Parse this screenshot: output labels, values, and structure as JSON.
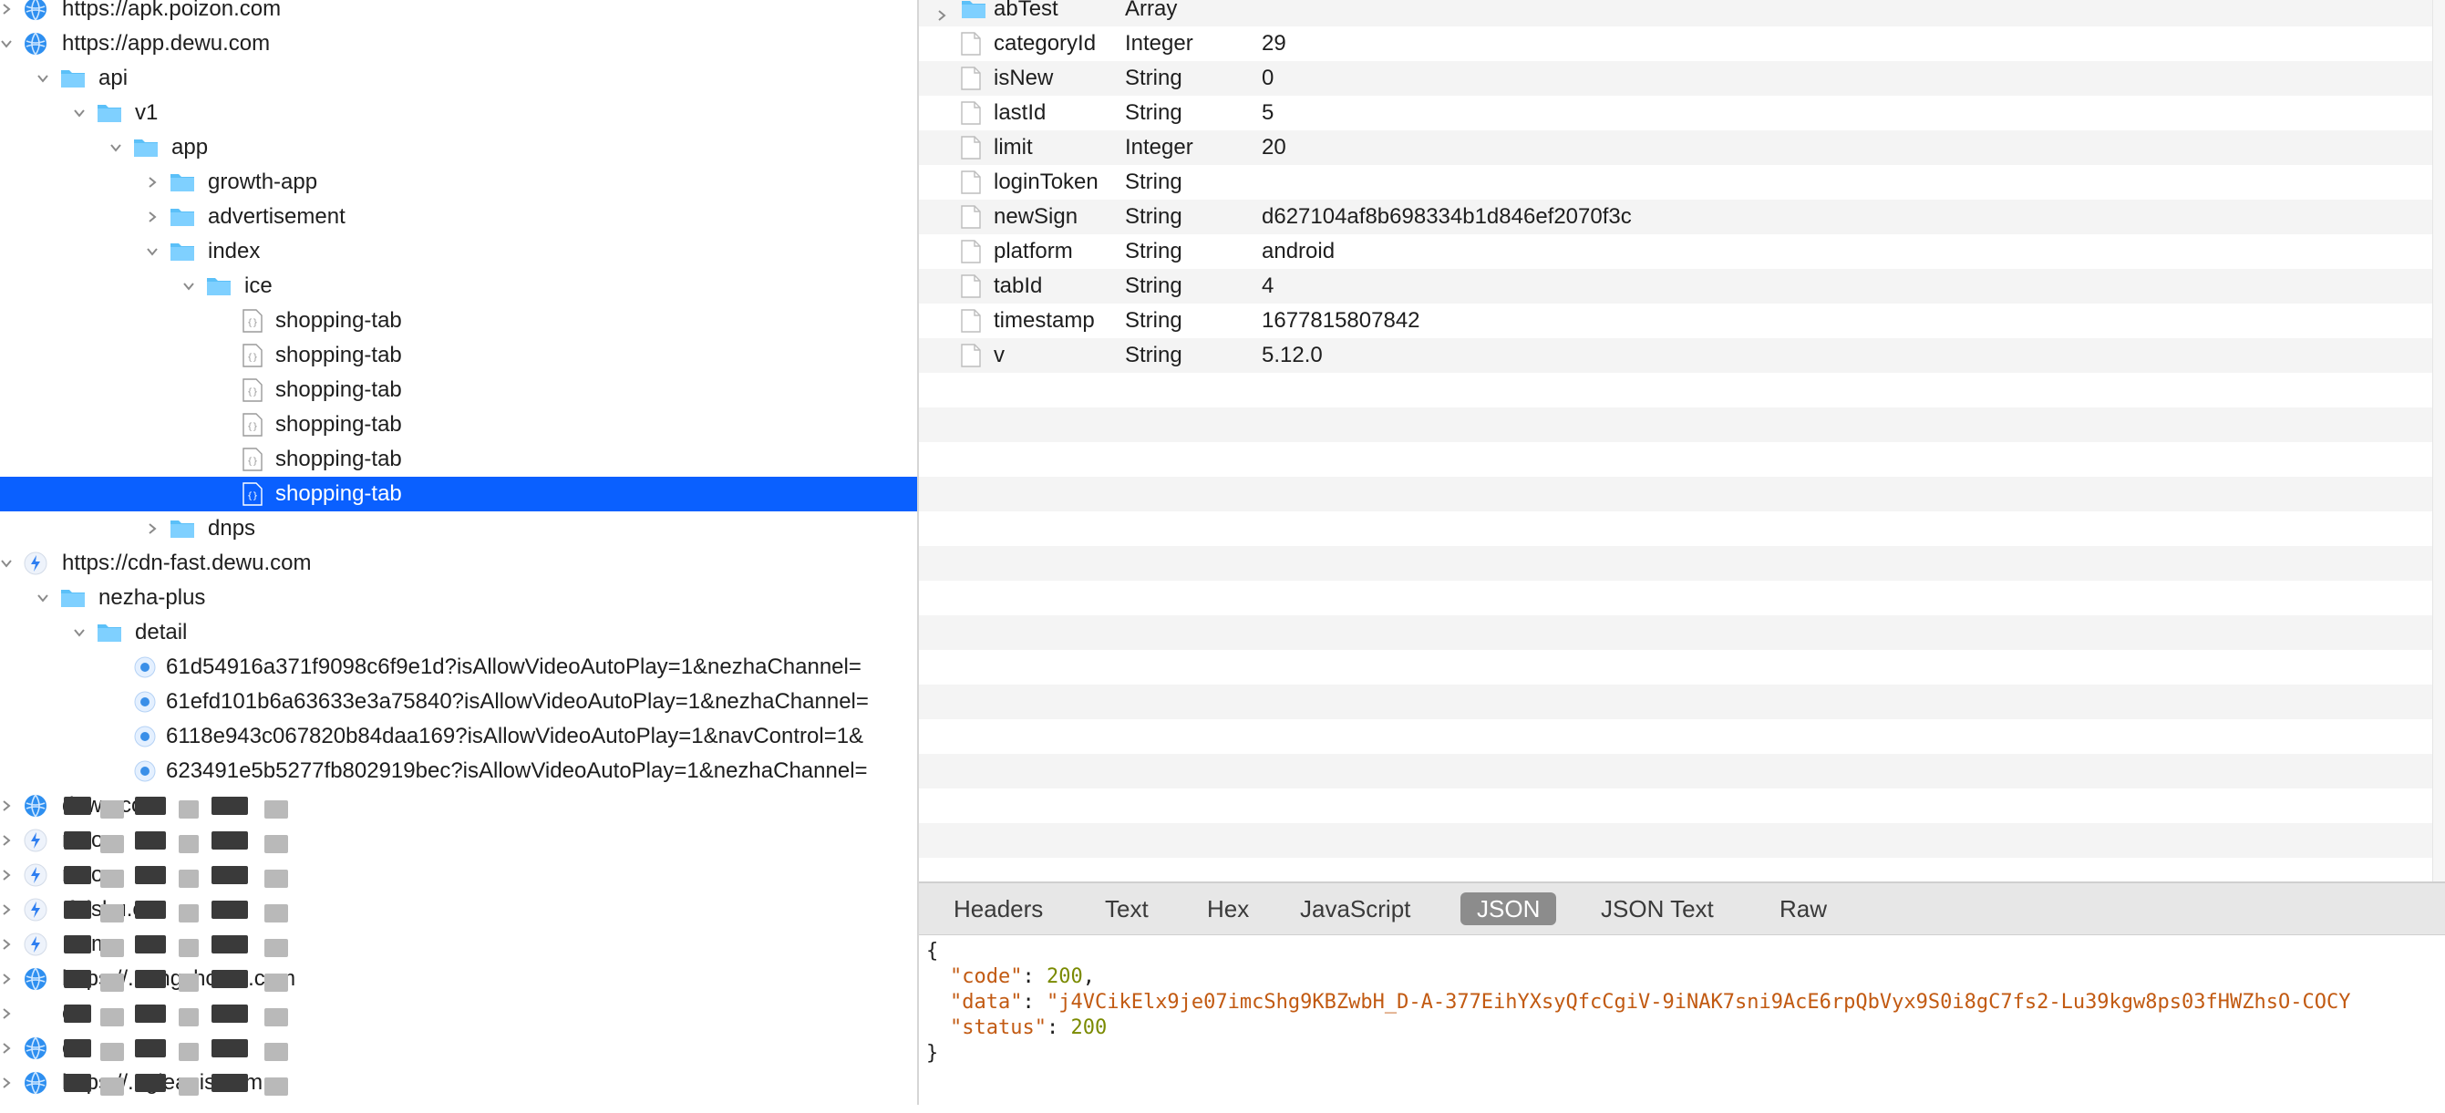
{
  "tree": {
    "rows": [
      {
        "depth": 0,
        "chevron": "right",
        "icon": "globe",
        "label": "https://apk.poizon.com"
      },
      {
        "depth": 0,
        "chevron": "down",
        "icon": "globe",
        "label": "https://app.dewu.com"
      },
      {
        "depth": 1,
        "chevron": "down",
        "icon": "folder",
        "label": "api"
      },
      {
        "depth": 2,
        "chevron": "down",
        "icon": "folder",
        "label": "v1"
      },
      {
        "depth": 3,
        "chevron": "down",
        "icon": "folder",
        "label": "app"
      },
      {
        "depth": 4,
        "chevron": "right",
        "icon": "folder",
        "label": "growth-app"
      },
      {
        "depth": 4,
        "chevron": "right",
        "icon": "folder",
        "label": "advertisement"
      },
      {
        "depth": 4,
        "chevron": "down",
        "icon": "folder",
        "label": "index"
      },
      {
        "depth": 5,
        "chevron": "down",
        "icon": "folder",
        "label": "ice"
      },
      {
        "depth": 6,
        "chevron": "none",
        "icon": "json",
        "label": "shopping-tab"
      },
      {
        "depth": 6,
        "chevron": "none",
        "icon": "json",
        "label": "shopping-tab"
      },
      {
        "depth": 6,
        "chevron": "none",
        "icon": "json",
        "label": "shopping-tab"
      },
      {
        "depth": 6,
        "chevron": "none",
        "icon": "json",
        "label": "shopping-tab"
      },
      {
        "depth": 6,
        "chevron": "none",
        "icon": "json",
        "label": "shopping-tab"
      },
      {
        "depth": 6,
        "chevron": "none",
        "icon": "json",
        "label": "shopping-tab",
        "selected": true
      },
      {
        "depth": 4,
        "chevron": "right",
        "icon": "folder",
        "label": "dnps"
      },
      {
        "depth": 0,
        "chevron": "down",
        "icon": "bolt",
        "label": "https://cdn-fast.dewu.com"
      },
      {
        "depth": 1,
        "chevron": "down",
        "icon": "folder",
        "label": "nezha-plus"
      },
      {
        "depth": 2,
        "chevron": "down",
        "icon": "folder",
        "label": "detail"
      },
      {
        "depth": 3,
        "chevron": "none",
        "icon": "page",
        "label": "61d54916a371f9098c6f9e1d?isAllowVideoAutoPlay=1&nezhaChannel="
      },
      {
        "depth": 3,
        "chevron": "none",
        "icon": "page",
        "label": "61efd101b6a63633e3a75840?isAllowVideoAutoPlay=1&nezhaChannel="
      },
      {
        "depth": 3,
        "chevron": "none",
        "icon": "page",
        "label": "6118e943c067820b84daa169?isAllowVideoAutoPlay=1&navControl=1&"
      },
      {
        "depth": 3,
        "chevron": "none",
        "icon": "page",
        "label": "623491e5b5277fb802919bec?isAllowVideoAutoPlay=1&nezhaChannel="
      },
      {
        "depth": 0,
        "chevron": "right",
        "icon": "globe",
        "label": "dewu.com",
        "redacted": true
      },
      {
        "depth": 0,
        "chevron": "right",
        "icon": "bolt",
        "label": "n.com",
        "redacted": true
      },
      {
        "depth": 0,
        "chevron": "right",
        "icon": "bolt",
        "label": "n.com",
        "redacted": true
      },
      {
        "depth": 0,
        "chevron": "right",
        "icon": "bolt",
        "label": ".feishu.cn",
        "redacted": true
      },
      {
        "depth": 0,
        "chevron": "right",
        "icon": "bolt",
        "label": ".com",
        "redacted": true
      },
      {
        "depth": 0,
        "chevron": "right",
        "icon": "globe",
        "label": "https://...angzhou....com",
        "redacted": true
      },
      {
        "depth": 0,
        "chevron": "right",
        "icon": "none",
        "label": "om",
        "redacted": true
      },
      {
        "depth": 0,
        "chevron": "right",
        "icon": "globe",
        "label": "om",
        "redacted": true
      },
      {
        "depth": 0,
        "chevron": "right",
        "icon": "globe",
        "label": "https://...gleapis.com",
        "redacted": true
      }
    ]
  },
  "params": {
    "rows": [
      {
        "key": "abTest",
        "type": "Array",
        "value": "",
        "folder": true
      },
      {
        "key": "categoryId",
        "type": "Integer",
        "value": "29"
      },
      {
        "key": "isNew",
        "type": "String",
        "value": "0"
      },
      {
        "key": "lastId",
        "type": "String",
        "value": "5"
      },
      {
        "key": "limit",
        "type": "Integer",
        "value": "20"
      },
      {
        "key": "loginToken",
        "type": "String",
        "value": ""
      },
      {
        "key": "newSign",
        "type": "String",
        "value": "d627104af8b698334b1d846ef2070f3c"
      },
      {
        "key": "platform",
        "type": "String",
        "value": "android"
      },
      {
        "key": "tabId",
        "type": "String",
        "value": "4"
      },
      {
        "key": "timestamp",
        "type": "String",
        "value": "1677815807842"
      },
      {
        "key": "v",
        "type": "String",
        "value": "5.12.0"
      }
    ]
  },
  "tabs": [
    {
      "label": "Headers"
    },
    {
      "label": "Text"
    },
    {
      "label": "Hex"
    },
    {
      "label": "JavaScript"
    },
    {
      "label": "JSON",
      "active": true
    },
    {
      "label": "JSON Text"
    },
    {
      "label": "Raw"
    }
  ],
  "json": {
    "open": "{",
    "close": "}",
    "code_key": "\"code\"",
    "code_val": "200",
    "data_key": "\"data\"",
    "data_val": "\"j4VCikElx9je07imcShg9KBZwbH_D-A-377EihYXsyQfcCgiV-9iNAK7sni9AcE6rpQbVyx9S0i8gC7fs2-Lu39kgw8ps03fHWZhsO-COCY",
    "status_key": "\"status\"",
    "status_val": "200"
  },
  "colors": {
    "selection": "#0a60ff",
    "folder": "#5bc0f8",
    "tab_active": "#8c8c8c"
  }
}
